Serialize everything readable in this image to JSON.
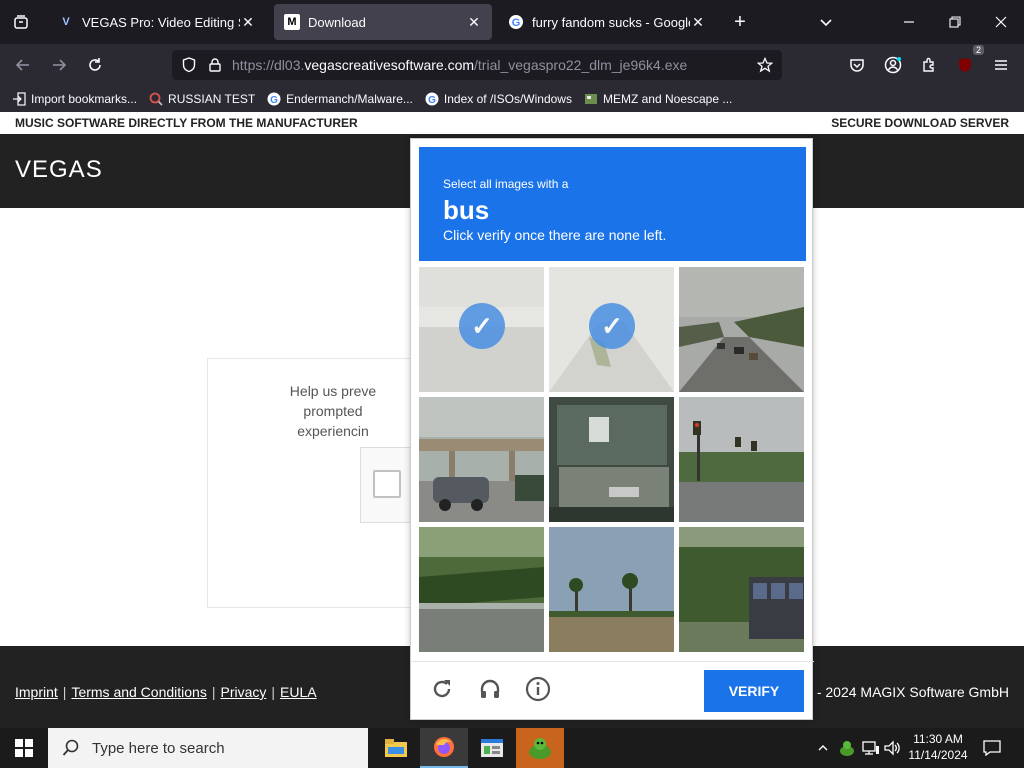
{
  "browser": {
    "tabs": [
      {
        "label": "VEGAS Pro: Video Editing Softw",
        "favicon": "V",
        "active": false
      },
      {
        "label": "Download",
        "favicon": "M",
        "active": true
      },
      {
        "label": "furry fandom sucks - Google Se",
        "favicon": "G",
        "active": false
      }
    ],
    "url_prefix": "https://dl03.",
    "url_domain": "vegascreativesoftware.com",
    "url_path": "/trial_vegaspro22_dlm_je96k4.exe",
    "extension_badge": "2",
    "bookmarks": [
      {
        "label": "Import bookmarks...",
        "icon": "import-icon"
      },
      {
        "label": "RUSSIAN TEST",
        "icon": "search-icon"
      },
      {
        "label": "Endermanch/Malware...",
        "icon": "google-icon"
      },
      {
        "label": "Index of /ISOs/Windows",
        "icon": "google-icon"
      },
      {
        "label": "MEMZ and Noescape ...",
        "icon": "image-icon"
      }
    ]
  },
  "site": {
    "top_left": "MUSIC SOFTWARE DIRECTLY FROM THE MANUFACTURER",
    "top_right": "SECURE DOWNLOAD SERVER",
    "logo": "VEGAS",
    "card_lines": [
      "Help us preve",
      "prompted",
      "experiencin"
    ],
    "footer_links": [
      "Imprint",
      "Terms and Conditions",
      "Privacy",
      "EULA"
    ],
    "copyright": "3 - 2024 MAGIX Software GmbH"
  },
  "captcha": {
    "prompt": "Select all images with a",
    "target": "bus",
    "instruction": "Click verify once there are none left.",
    "verify_label": "VERIFY",
    "tiles": [
      {
        "scene": "blank road, faded",
        "selected": true
      },
      {
        "scene": "road with small object, faded",
        "selected": true
      },
      {
        "scene": "highway with cars and trees",
        "selected": false
      },
      {
        "scene": "overpass with car",
        "selected": false
      },
      {
        "scene": "bus front window close-up",
        "selected": false
      },
      {
        "scene": "intersection with traffic lights",
        "selected": false
      },
      {
        "scene": "bridge guardrail and trees",
        "selected": false
      },
      {
        "scene": "palm trees and sky",
        "selected": false
      },
      {
        "scene": "bus side among trees",
        "selected": false
      }
    ]
  },
  "taskbar": {
    "search_placeholder": "Type here to search",
    "time": "11:30 AM",
    "date": "11/14/2024"
  },
  "colors": {
    "captcha_blue": "#1a73e8",
    "site_dark": "#222222",
    "browser_bg": "#1c1b22"
  }
}
